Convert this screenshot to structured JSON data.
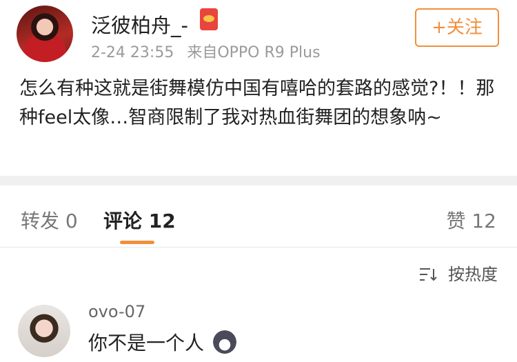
{
  "post": {
    "username": "泛彼柏舟_-",
    "timestamp": "2-24 23:55",
    "source": "来自OPPO R9 Plus",
    "follow_label": "+关注",
    "text": "怎么有种这就是街舞模仿中国有嘻哈的套路的感觉?！！那种feel太像…智商限制了我对热血街舞团的想象呐~",
    "badge_icon": "red-envelope-icon"
  },
  "tabs": {
    "repost_label": "转发 0",
    "comments_label": "评论 12",
    "likes_label": "赞 12",
    "active": "comments",
    "accent": "#f08f3a"
  },
  "sort": {
    "label": "按热度",
    "icon": "sort-icon"
  },
  "comments": [
    {
      "name": "ovo-07",
      "text": "你不是一个人",
      "emoji": "husky-dog-emoji-icon"
    }
  ]
}
